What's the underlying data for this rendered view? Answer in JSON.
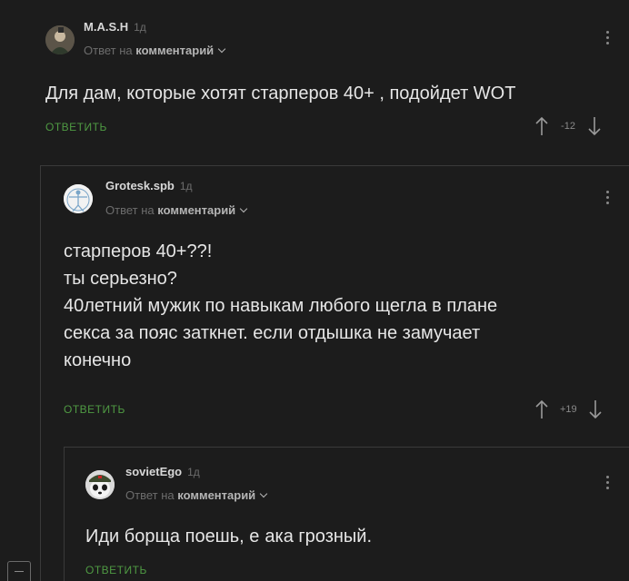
{
  "comments": [
    {
      "author": "M.A.S.H",
      "age": "1д",
      "reply_prefix": "Ответ на",
      "reply_target": "комментарий",
      "text": [
        "Для дам, которые хотят старперов 40+ , подойдет WOT"
      ],
      "reply_label": "ОТВЕТИТЬ",
      "rating": "-12"
    },
    {
      "author": "Grotesk.spb",
      "age": "1д",
      "reply_prefix": "Ответ на",
      "reply_target": "комментарий",
      "text": [
        "старперов 40+??!",
        "ты серьезно?",
        "40летний мужик по навыкам любого щегла в плане",
        "секса за пояс заткнет. если отдышка не замучает",
        "конечно"
      ],
      "reply_label": "ОТВЕТИТЬ",
      "rating": "+19"
    },
    {
      "author": "sovietEgo",
      "age": "1д",
      "reply_prefix": "Ответ на",
      "reply_target": "комментарий",
      "text_before": "Иди борща поешь, е",
      "text_after": "ака грозный.",
      "reply_label": "ОТВЕТИТЬ"
    }
  ],
  "colors": {
    "background": "#1c1c1c",
    "reply_green": "#4f9a43",
    "muted": "#6d6d6d"
  },
  "icons": [
    "kebab-menu-icon",
    "upvote-arrow-icon",
    "downvote-arrow-icon",
    "chevron-down-icon"
  ]
}
